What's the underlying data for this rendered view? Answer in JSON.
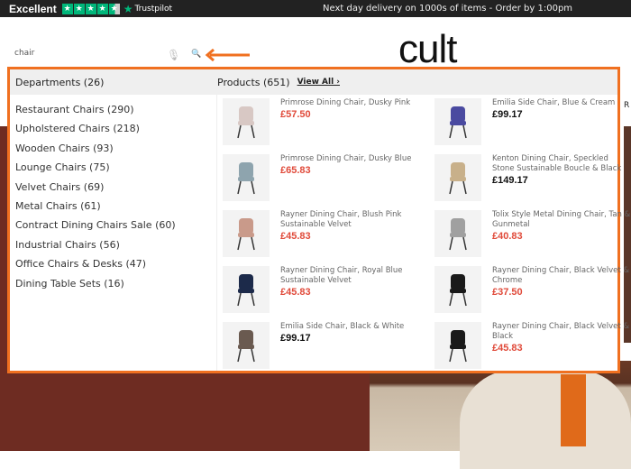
{
  "topbar": {
    "rating": "Excellent",
    "stars": 4.5,
    "trustpilot": "Trustpilot",
    "delivery": "Next day delivery on 1000s of items - Order by 1:00pm"
  },
  "search": {
    "value": "chair",
    "mic_icon": "microphone-icon",
    "search_icon": "search-icon"
  },
  "logo": "cult",
  "colors": {
    "accent": "#f07020",
    "sale_price": "#e04a3a",
    "trustpilot": "#00b67a"
  },
  "departments": {
    "title": "Departments (26)",
    "items": [
      "Restaurant Chairs  (290)",
      "Upholstered Chairs  (218)",
      "Wooden Chairs  (93)",
      "Lounge Chairs  (75)",
      "Velvet Chairs  (69)",
      "Metal Chairs  (61)",
      "Contract Dining Chairs Sale  (60)",
      "Industrial Chairs  (56)",
      "Office Chairs & Desks  (47)",
      "Dining Table Sets  (16)"
    ]
  },
  "products": {
    "title": "Products (651)",
    "view_all": "View All ›",
    "left": [
      {
        "name": "Primrose Dining Chair, Dusky Pink",
        "price": "£57.50",
        "sale": true,
        "color": "#d8c8c4"
      },
      {
        "name": "Primrose Dining Chair, Dusky Blue",
        "price": "£65.83",
        "sale": true,
        "color": "#8ea4ae"
      },
      {
        "name": "Rayner Dining Chair, Blush Pink Sustainable Velvet",
        "price": "£45.83",
        "sale": true,
        "color": "#c99a8a"
      },
      {
        "name": "Rayner Dining Chair, Royal Blue Sustainable Velvet",
        "price": "£45.83",
        "sale": true,
        "color": "#1c2a4a"
      },
      {
        "name": "Emilia Side Chair, Black & White",
        "price": "£99.17",
        "sale": false,
        "color": "#6a5a50"
      }
    ],
    "right": [
      {
        "name": "Emilia Side Chair, Blue & Cream",
        "price": "£99.17",
        "sale": false,
        "color": "#4a4aa0"
      },
      {
        "name": "Kenton Dining Chair, Speckled Stone Sustainable Boucle & Black",
        "price": "£149.17",
        "sale": false,
        "color": "#c8b08a"
      },
      {
        "name": "Tolix Style Metal Dining Chair, Tan & Gunmetal",
        "price": "£40.83",
        "sale": true,
        "color": "#a0a0a0"
      },
      {
        "name": "Rayner Dining Chair, Black Velvet & Chrome",
        "price": "£37.50",
        "sale": true,
        "color": "#1a1a1a"
      },
      {
        "name": "Rayner Dining Chair, Black Velvet & Black",
        "price": "£45.83",
        "sale": true,
        "color": "#1a1a1a"
      }
    ]
  }
}
